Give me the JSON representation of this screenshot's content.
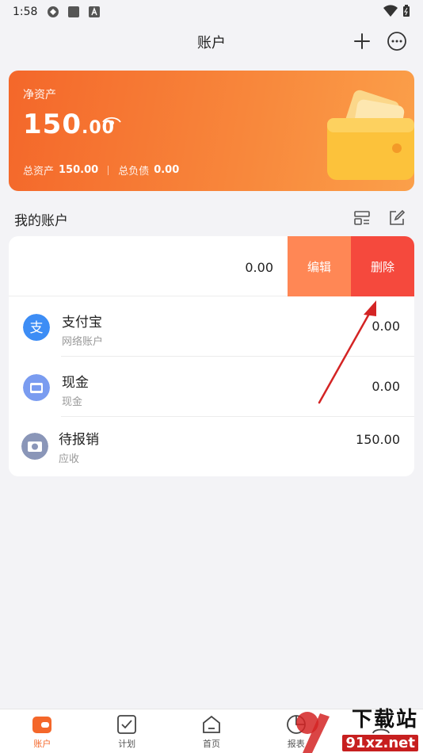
{
  "status_bar": {
    "time": "1:58"
  },
  "header": {
    "title": "账户"
  },
  "asset_card": {
    "net_label": "净资产",
    "net_int": "150",
    "net_dec": ".00",
    "total_assets_label": "总资产",
    "total_assets_value": "150.00",
    "total_liab_label": "总负债",
    "total_liab_value": "0.00"
  },
  "section": {
    "title": "我的账户"
  },
  "accounts": [
    {
      "amount": "0.00",
      "edit_label": "编辑",
      "delete_label": "删除"
    },
    {
      "name": "支付宝",
      "sub": "网络账户",
      "amount": "0.00",
      "icon": "alipay-icon",
      "color": "#3d8df5"
    },
    {
      "name": "现金",
      "sub": "现金",
      "amount": "0.00",
      "icon": "cash-icon",
      "color": "#7a9cf0"
    },
    {
      "name": "待报销",
      "sub": "应收",
      "amount": "150.00",
      "icon": "reimburse-icon",
      "color": "#8a96b8"
    }
  ],
  "tabs": [
    {
      "label": "账户",
      "icon": "wallet-tab-icon",
      "active": true
    },
    {
      "label": "计划",
      "icon": "check-tab-icon"
    },
    {
      "label": "首页",
      "icon": "home-tab-icon"
    },
    {
      "label": "报表",
      "icon": "chart-tab-icon"
    },
    {
      "label": "我的",
      "icon": "user-tab-icon"
    }
  ],
  "watermark": {
    "line1": "下载站",
    "line2": "91xz.net"
  },
  "colors": {
    "accent": "#f4672a",
    "edit": "#ff8755",
    "delete": "#f5493d"
  }
}
